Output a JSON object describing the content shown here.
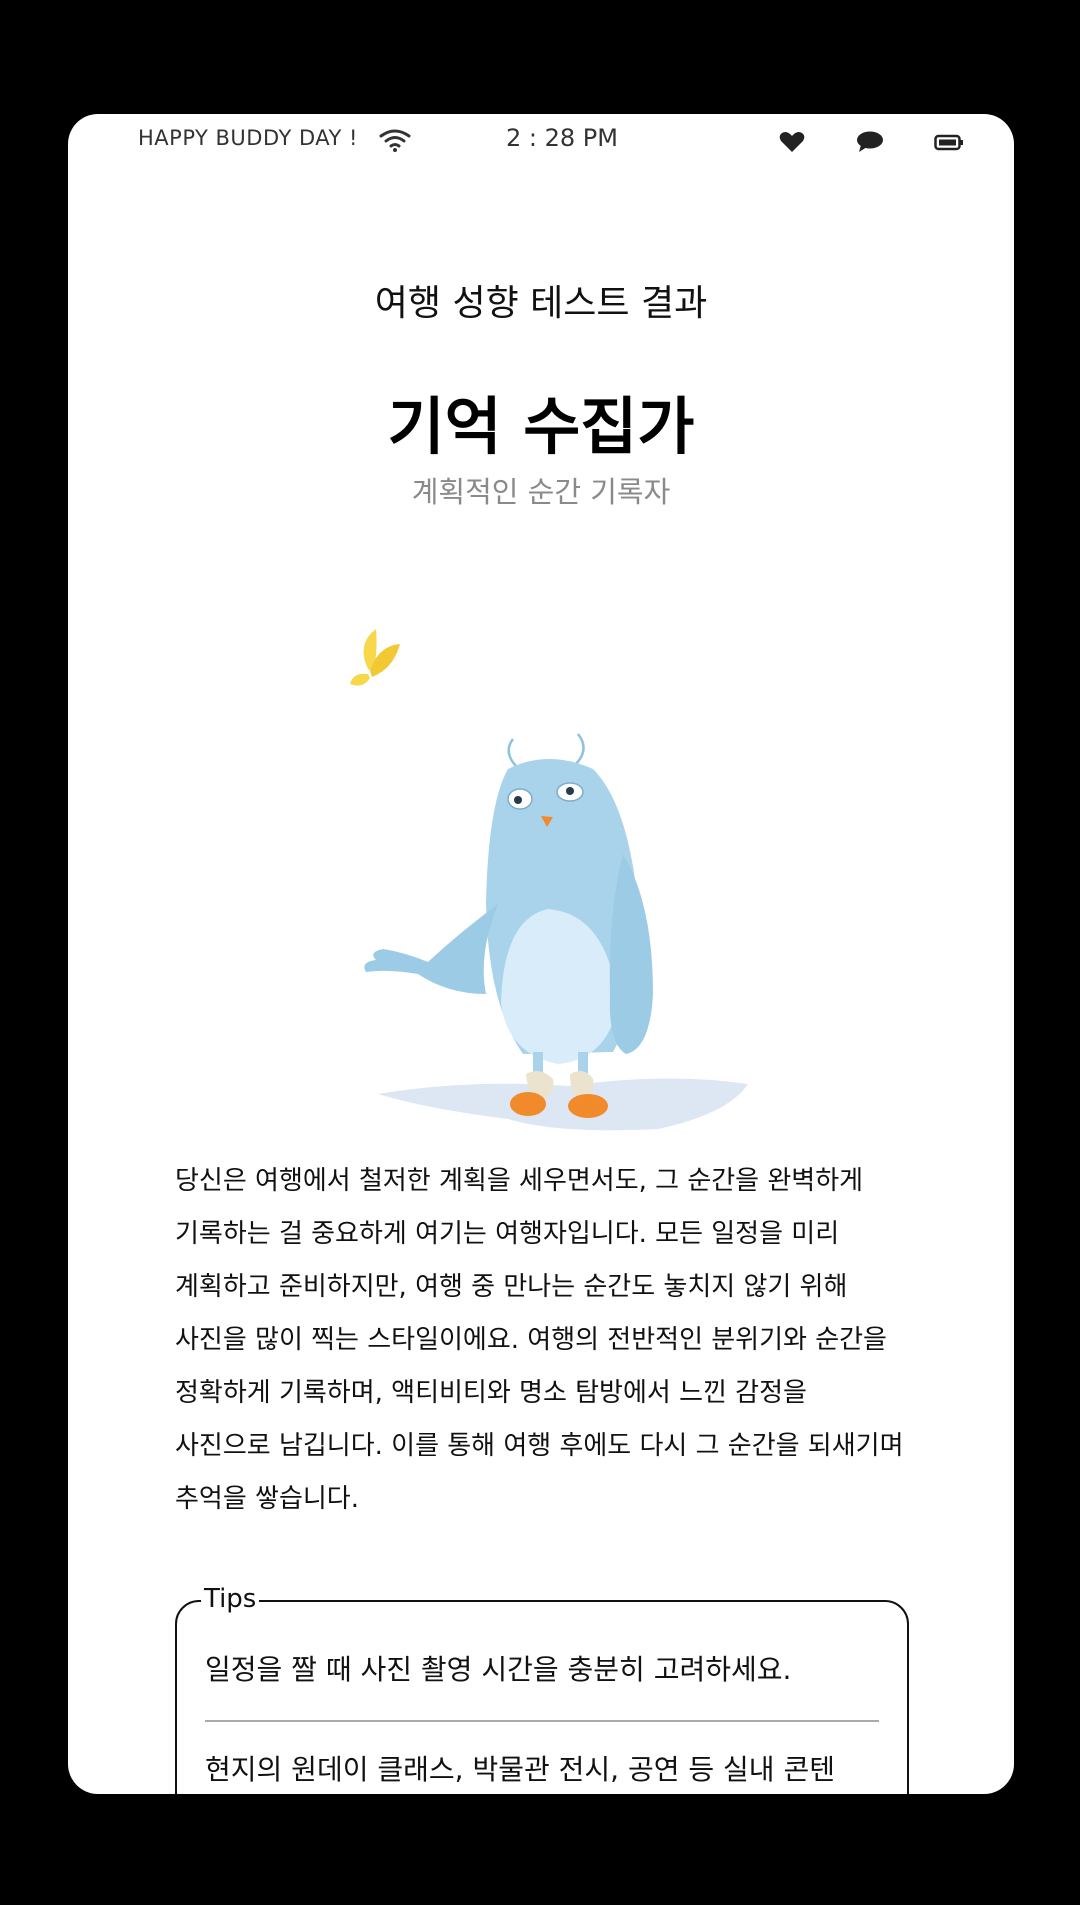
{
  "status_bar": {
    "greeting": "HAPPY BUDDY DAY !",
    "time": "2 : 28 PM",
    "icons": [
      "wifi-icon",
      "heart-icon",
      "chat-icon",
      "battery-icon"
    ]
  },
  "result": {
    "label": "여행 성향 테스트 결과",
    "title": "기억 수집가",
    "subtitle": "계획적인 순간 기록자"
  },
  "description": "당신은 여행에서 철저한 계획을 세우면서도, 그 순간을 완벽하게 기록하는 걸 중요하게 여기는 여행자입니다. 모든 일정을 미리 계획하고 준비하지만, 여행 중 만나는 순간도 놓치지 않기 위해 사진을 많이 찍는 스타일이에요. 여행의 전반적인 분위기와 순간을 정확하게 기록하며, 액티비티와 명소 탐방에서 느낀 감정을 사진으로 남깁니다. 이를 통해 여행 후에도 다시 그 순간을 되새기며 추억을 쌓습니다.",
  "tips": {
    "legend": "Tips",
    "items": [
      "일정을 짤 때 사진 촬영 시간을 충분히 고려하세요.",
      "현지의 원데이 클래스, 박물관 전시, 공연 등 실내 콘텐"
    ]
  },
  "colors": {
    "background": "#000000",
    "card": "#ffffff",
    "subtitle_gray": "#8a8a8a",
    "mascot_blue": "#a9d3ea",
    "butterfly_yellow": "#f7d84a",
    "feet_orange": "#f08a2a"
  }
}
